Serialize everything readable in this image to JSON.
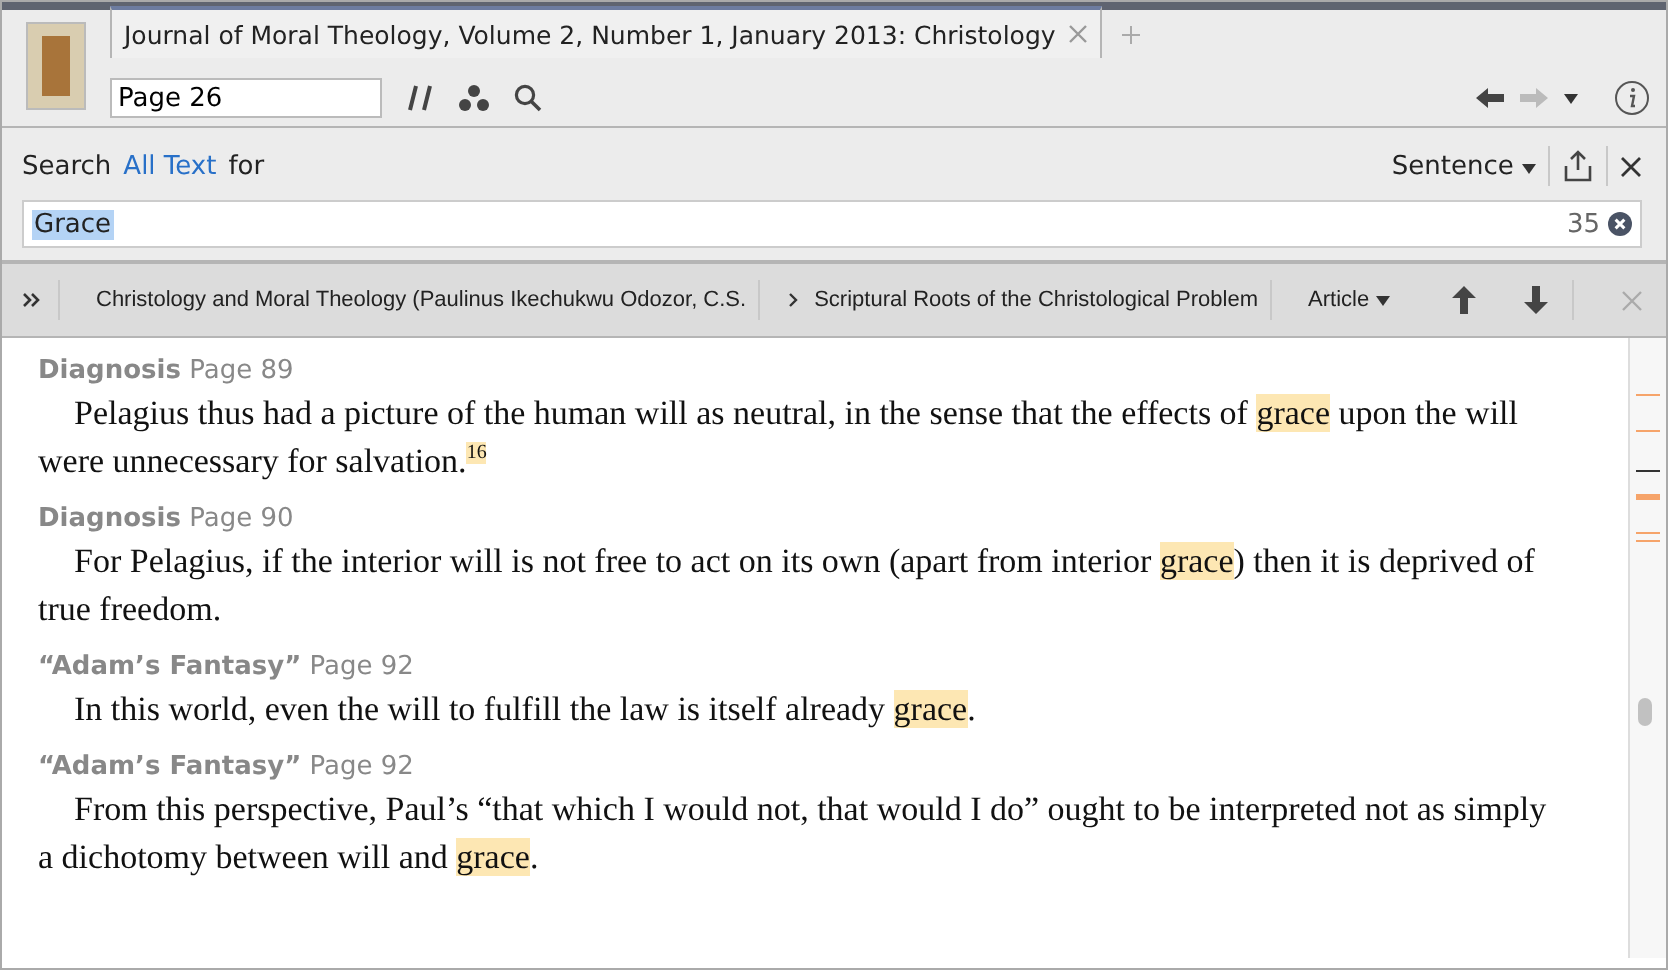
{
  "tabs": [
    {
      "label": "Journal of Moral Theology, Volume 2, Number 1, January 2013: Christology",
      "selected": true
    }
  ],
  "toolbar": {
    "reference": "Page 26"
  },
  "search": {
    "label": "Search",
    "scope": "All Text",
    "suffix": "for",
    "mode": "Sentence",
    "query": "Grace",
    "count": "35"
  },
  "breadcrumb": {
    "items": [
      "Christology and Moral Theology (Paulinus Ikechukwu Odozor, C.S.",
      "Scriptural Roots of the Christological Problem"
    ],
    "unit": "Article"
  },
  "results": [
    {
      "heading": "Diagnosis",
      "page": "Page 89",
      "segments": [
        {
          "kind": "text",
          "text": "Pelagius thus had a picture of the human will as neutral, in the sense that the effects of "
        },
        {
          "kind": "hit",
          "text": "grace"
        },
        {
          "kind": "text",
          "text": " upon the will were unnecessary for salvation."
        },
        {
          "kind": "footnote",
          "text": "16"
        }
      ]
    },
    {
      "heading": "Diagnosis",
      "page": "Page 90",
      "segments": [
        {
          "kind": "text",
          "text": "For Pelagius, if the interior will is not free to act on its own (apart from interior "
        },
        {
          "kind": "hit",
          "text": "grace"
        },
        {
          "kind": "text",
          "text": ") then it is deprived of true freedom."
        }
      ]
    },
    {
      "heading": "“Adam’s Fantasy”",
      "page": "Page 92",
      "segments": [
        {
          "kind": "text",
          "text": "In this world, even the will to fulfill the law is itself already "
        },
        {
          "kind": "hit",
          "text": "grace"
        },
        {
          "kind": "text",
          "text": "."
        }
      ]
    },
    {
      "heading": "“Adam’s Fantasy”",
      "page": "Page 92",
      "segments": [
        {
          "kind": "text",
          "text": "From this perspective, Paul’s “that which I would not, that would I do” ought to be interpreted not as simply a dichotomy between will and "
        },
        {
          "kind": "hit",
          "text": "grace"
        },
        {
          "kind": "text",
          "text": "."
        }
      ]
    }
  ]
}
